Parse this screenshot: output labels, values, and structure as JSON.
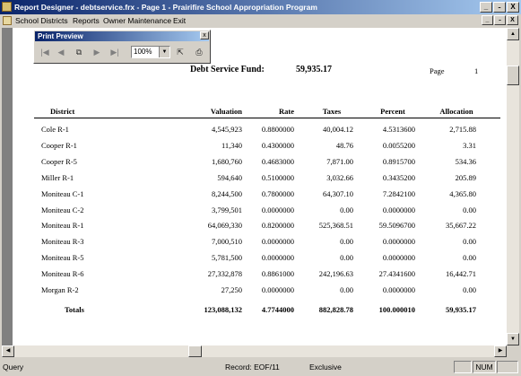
{
  "window": {
    "title": "Report Designer - debtservice.frx - Page 1 - Prairifire School Appropriation Program",
    "minimize": "_",
    "restore": "̵",
    "close": "X"
  },
  "menu": {
    "items": [
      "School Districts",
      "Reports",
      "Owner Maintenance",
      "Exit"
    ]
  },
  "print_preview": {
    "title": "Print Preview",
    "close": "x",
    "zoom": "100%"
  },
  "report": {
    "fund_label": "Debt Service Fund:",
    "fund_total": "59,935.17",
    "page_label": "Page",
    "page_number": "1",
    "columns": [
      "District",
      "Valuation",
      "Rate",
      "Taxes",
      "Percent",
      "Allocation"
    ],
    "rows": [
      [
        "Cole R-1",
        "4,545,923",
        "0.8800000",
        "40,004.12",
        "4.5313600",
        "2,715.88"
      ],
      [
        "Cooper R-1",
        "11,340",
        "0.4300000",
        "48.76",
        "0.0055200",
        "3.31"
      ],
      [
        "Cooper R-5",
        "1,680,760",
        "0.4683000",
        "7,871.00",
        "0.8915700",
        "534.36"
      ],
      [
        "Miller R-1",
        "594,640",
        "0.5100000",
        "3,032.66",
        "0.3435200",
        "205.89"
      ],
      [
        "Moniteau C-1",
        "8,244,500",
        "0.7800000",
        "64,307.10",
        "7.2842100",
        "4,365.80"
      ],
      [
        "Moniteau C-2",
        "3,799,501",
        "0.0000000",
        "0.00",
        "0.0000000",
        "0.00"
      ],
      [
        "Moniteau R-1",
        "64,069,330",
        "0.8200000",
        "525,368.51",
        "59.5096700",
        "35,667.22"
      ],
      [
        "Moniteau R-3",
        "7,000,510",
        "0.0000000",
        "0.00",
        "0.0000000",
        "0.00"
      ],
      [
        "Moniteau R-5",
        "5,781,500",
        "0.0000000",
        "0.00",
        "0.0000000",
        "0.00"
      ],
      [
        "Moniteau R-6",
        "27,332,878",
        "0.8861000",
        "242,196.63",
        "27.4341600",
        "16,442.71"
      ],
      [
        "Morgan R-2",
        "27,250",
        "0.0000000",
        "0.00",
        "0.0000000",
        "0.00"
      ]
    ],
    "totals": [
      "Totals",
      "123,088,132",
      "4.7744000",
      "882,828.78",
      "100.000010",
      "59,935.17"
    ]
  },
  "status": {
    "left": "Query",
    "record": "Record: EOF/11",
    "mode": "Exclusive",
    "num": "NUM"
  },
  "colors": {
    "title_gradient_start": "#0a246a",
    "title_gradient_end": "#a6caf0",
    "chrome": "#d4d0c8",
    "workspace": "#808080"
  }
}
